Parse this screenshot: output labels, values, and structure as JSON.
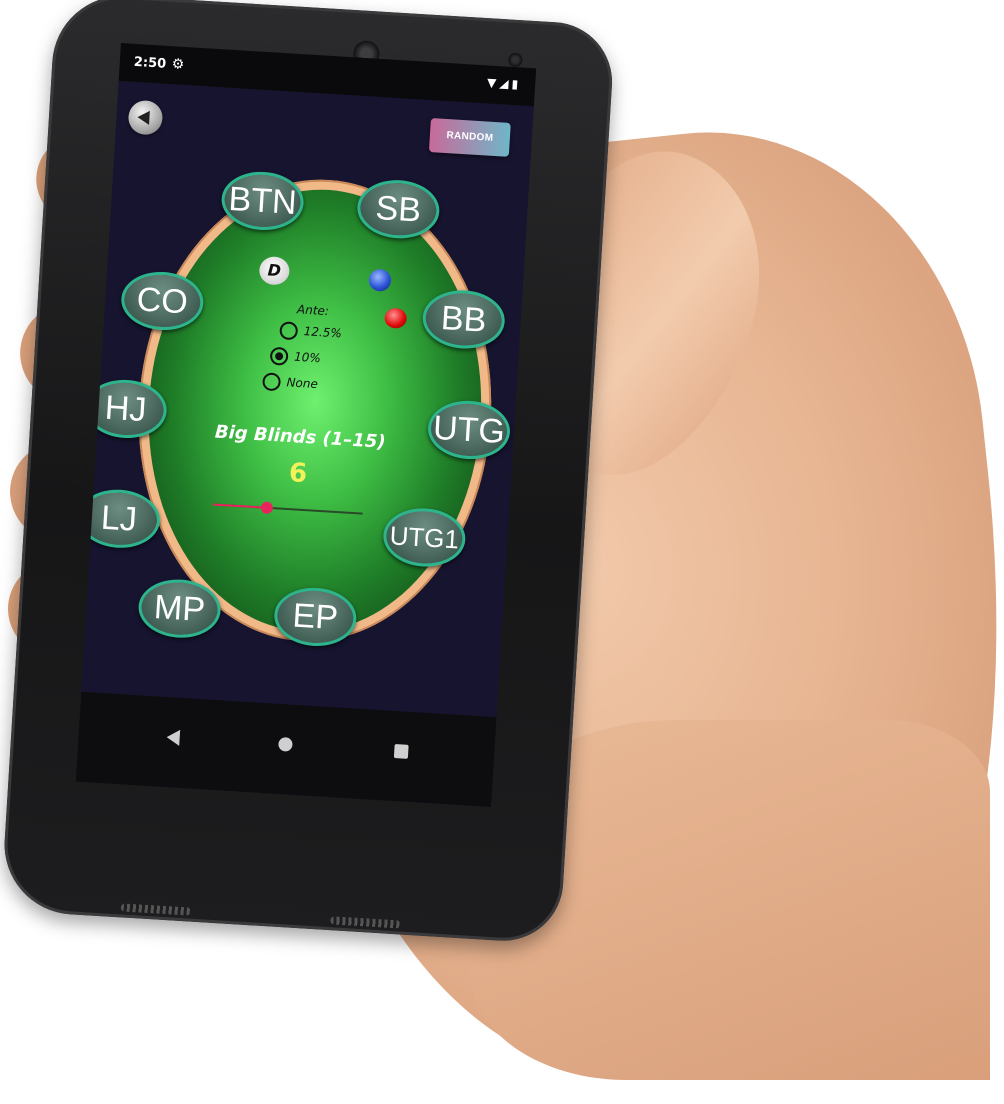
{
  "status_bar": {
    "time": "2:50",
    "settings_icon": "gear-icon",
    "indicators": [
      "wifi-icon",
      "signal-icon",
      "battery-icon"
    ]
  },
  "header": {
    "back_icon": "back-arrow-icon",
    "random_label": "RANDOM"
  },
  "table": {
    "seats": [
      {
        "id": "btn",
        "label": "BTN"
      },
      {
        "id": "sb",
        "label": "SB"
      },
      {
        "id": "co",
        "label": "CO"
      },
      {
        "id": "bb",
        "label": "BB"
      },
      {
        "id": "hj",
        "label": "HJ"
      },
      {
        "id": "utg",
        "label": "UTG"
      },
      {
        "id": "lj",
        "label": "LJ"
      },
      {
        "id": "utg1",
        "label": "UTG1"
      },
      {
        "id": "mp",
        "label": "MP"
      },
      {
        "id": "ep",
        "label": "EP"
      }
    ],
    "dealer_chip": "D",
    "chips": [
      "blue-chip",
      "red-chip"
    ]
  },
  "ante": {
    "label": "Ante:",
    "options": [
      "12.5%",
      "10%",
      "None"
    ],
    "selected": "10%"
  },
  "big_blinds": {
    "title": "Big Blinds (1–15)",
    "value": "6",
    "min": 1,
    "max": 15,
    "current": 6
  },
  "colors": {
    "screen_bg": "#171430",
    "felt_center": "#6ff06f",
    "rail": "#f1b888",
    "seat_border": "#2db48d",
    "value_yellow": "#f4f25a",
    "slider_accent": "#e8245c",
    "random_gradient_start": "#c86a9a",
    "random_gradient_end": "#6fb6c8"
  },
  "nav_bar": [
    "back-nav-icon",
    "home-nav-icon",
    "recents-nav-icon"
  ]
}
